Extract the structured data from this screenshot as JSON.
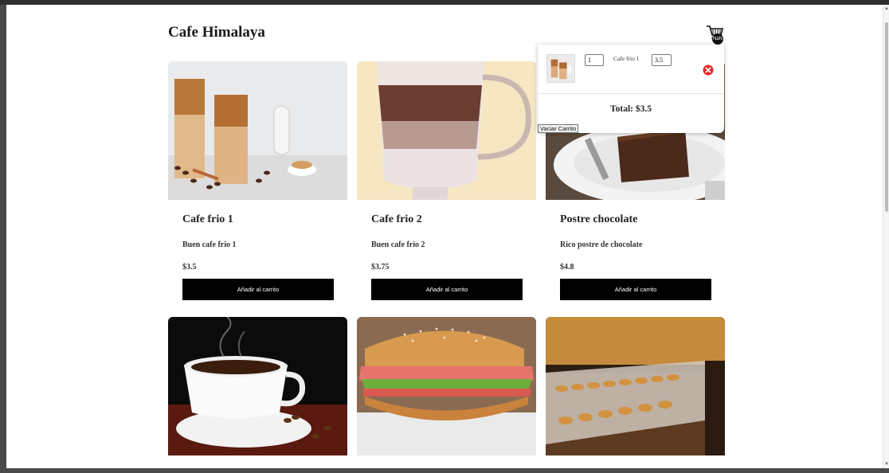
{
  "header": {
    "title": "Cafe Himalaya",
    "cart_badge": "NaN"
  },
  "products": [
    {
      "name": "Cafe frio 1",
      "desc": "Buen cafe frio 1",
      "price": "$3.5",
      "button": "Añadir al carrito"
    },
    {
      "name": "Cafe frio 2",
      "desc": "Buen cafe frio 2",
      "price": "$3.75",
      "button": "Añadir al carrito"
    },
    {
      "name": "Postre chocolate",
      "desc": "Rico postre de chocolate",
      "price": "$4.8",
      "button": "Añadir al carrito"
    }
  ],
  "cart": {
    "item": {
      "qty": "1",
      "name": "Cafe frio 1",
      "price": "3.5"
    },
    "total": "Total: $3.5",
    "clear_label": "Vaciar Carrito"
  },
  "colors": {
    "button_bg": "#000000",
    "remove_icon": "#e8262b"
  },
  "icons": [
    "cart-icon",
    "remove-item-icon"
  ]
}
